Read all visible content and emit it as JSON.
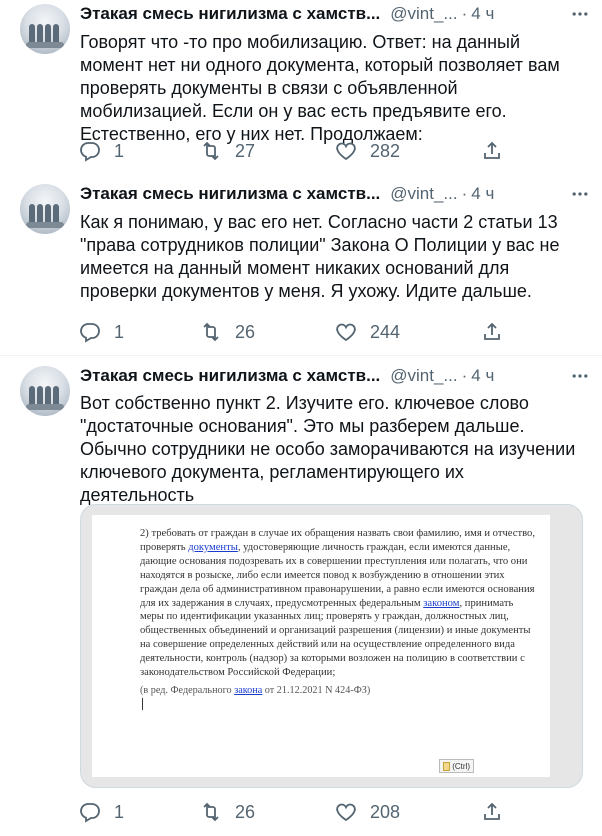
{
  "tweets": [
    {
      "author_name": "Этакая смесь нигилизма с хамств...",
      "handle": "@vint_...",
      "separator": "·",
      "time": "4 ч",
      "text": "Говорят что -то про мобилизацию. Ответ: на данный момент нет ни одного документа, который позволяет вам проверять документы в связи с объявленной мобилизацией. Если он у вас есть предъявите его. Естественно, его у них нет. Продолжаем:",
      "replies": "1",
      "retweets": "27",
      "likes": "282"
    },
    {
      "author_name": "Этакая смесь нигилизма с хамств...",
      "handle": "@vint_...",
      "separator": "·",
      "time": "4 ч",
      "text": "Как я понимаю, у вас его нет. Согласно части 2 статьи 13 \"права сотрудников полиции\" Закона О Полиции у вас не имеется на данный момент никаких оснований для проверки документов у меня. Я ухожу. Идите дальше.",
      "replies": "1",
      "retweets": "26",
      "likes": "244"
    },
    {
      "author_name": "Этакая смесь нигилизма с хамств...",
      "handle": "@vint_...",
      "separator": "·",
      "time": "4 ч",
      "text": "Вот собственно пункт 2. Изучите его. ключевое слово \"достаточные основания\". Это мы разберем дальше. Обычно сотрудники не особо заморачиваются на изучении ключевого документа, регламентирующего их деятельность",
      "replies": "1",
      "retweets": "26",
      "likes": "208"
    }
  ],
  "document_image": {
    "p1_a": "2) требовать от граждан в случае их обращения назвать свои фамилию, имя и отчество, проверять ",
    "p1_link1": "документы",
    "p1_b": ", удостоверяющие личность граждан, если имеются данные, дающие основания подозревать их в совершении преступления или полагать, что они находятся в розыске, либо если имеется повод к возбуждению в отношении этих граждан дела об административном правонарушении, а равно если имеются основания для их задержания в случаях, предусмотренных федеральным ",
    "p1_link2": "законом",
    "p1_c": ", принимать меры по идентификации указанных лиц; проверять у граждан, должностных лиц, общественных объединений и организаций разрешения (лицензии) и иные документы на совершение определенных действий или на осуществление определенного вида деятельности, контроль (надзор) за которыми возложен на полицию в соответствии с законодательством Российской Федерации;",
    "ref_a": "(в ред. Федерального ",
    "ref_link": "закона",
    "ref_b": " от 21.12.2021 N 424-ФЗ)",
    "paste_label": "(Ctrl)"
  },
  "icons": {
    "reply": "reply-icon",
    "retweet": "retweet-icon",
    "like": "heart-icon",
    "share": "share-icon",
    "more": "more-icon"
  },
  "colors": {
    "secondary_text": "#536471",
    "link": "#1a3ccc",
    "divider": "#eff3f4"
  }
}
